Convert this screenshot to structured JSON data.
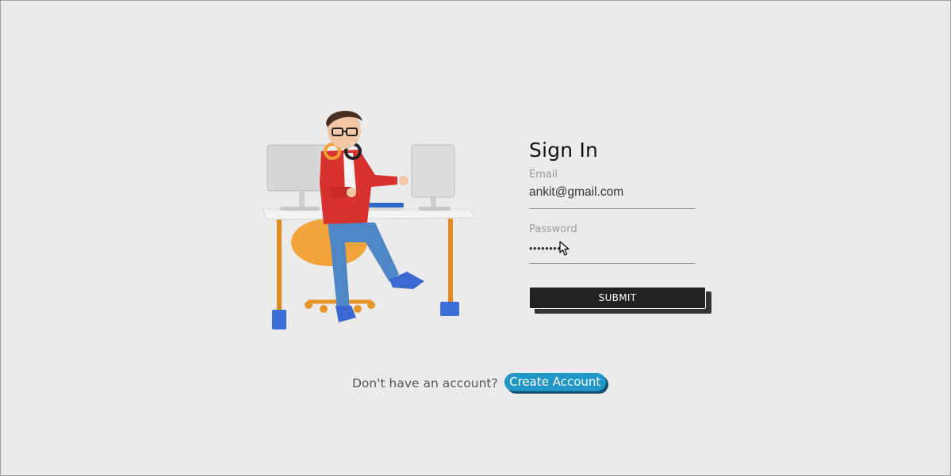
{
  "signin": {
    "title": "Sign In",
    "email_label": "Email",
    "email_value": "ankit@gmail.com",
    "password_label": "Password",
    "password_value": "••••••••",
    "submit_label": "SUBMIT"
  },
  "signup": {
    "prompt": "Don't have an account?",
    "button_label": "Create Account"
  },
  "colors": {
    "background": "#ebebeb",
    "submit": "#222222",
    "create_account": "#2196c9",
    "shirt": "#d8322f",
    "pants": "#4f86c6",
    "chair": "#f2a33a"
  },
  "illustration": {
    "icon": "person-at-desk-illustration"
  }
}
